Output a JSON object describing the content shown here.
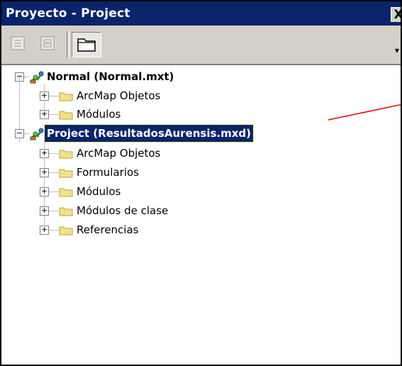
{
  "window": {
    "title": "Proyecto - Project",
    "close_label": "X"
  },
  "toolbar": {
    "buttons": [
      {
        "icon": "view-object-icon",
        "state": "disabled"
      },
      {
        "icon": "view-code-icon",
        "state": "disabled"
      },
      {
        "icon": "toggle-folders-icon",
        "state": "pressed"
      }
    ]
  },
  "tree": {
    "projects": [
      {
        "label": "Normal (Normal.mxt)",
        "selected": false,
        "folders": [
          "ArcMap Objetos",
          "Módulos"
        ]
      },
      {
        "label": "Project (ResultadosAurensis.mxd)",
        "selected": true,
        "folders": [
          "ArcMap Objetos",
          "Formularios",
          "Módulos",
          "Módulos de clase",
          "Referencias"
        ]
      }
    ]
  },
  "colors": {
    "titlebar": "#0a246a",
    "selection": "#0a246a",
    "folder": "#f5e08a",
    "annotation_arrow": "#e00000"
  }
}
